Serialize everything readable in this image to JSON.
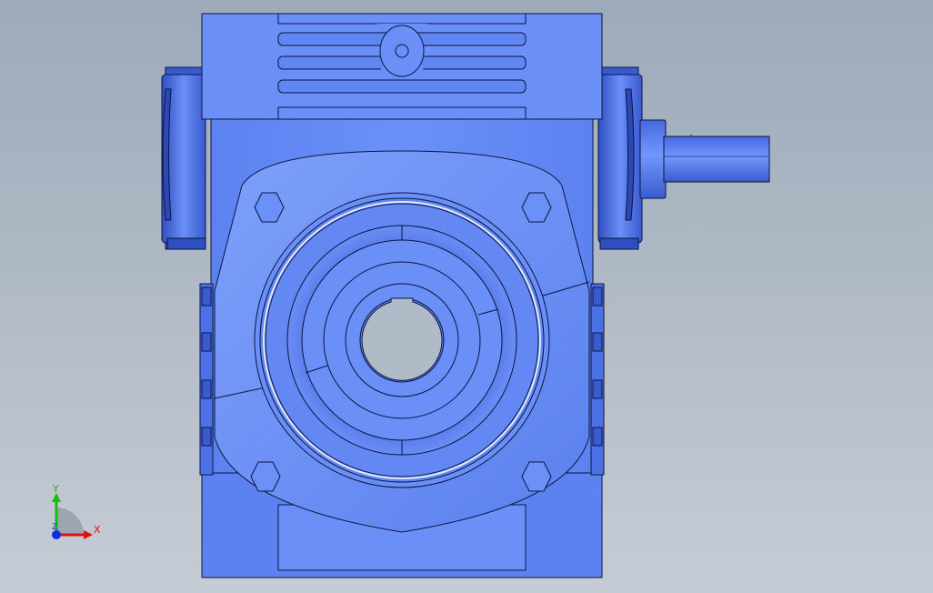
{
  "viewport": {
    "background_top": "#9daab9",
    "background_bottom": "#c6ccd5"
  },
  "model": {
    "body_color": "#5f87f2",
    "body_light": "#7a9dfa",
    "body_dark": "#3a5fd0",
    "edge_color": "#0b1540"
  },
  "triad": {
    "x_label": "X",
    "y_label": "Y",
    "z_label": "Z",
    "x_color": "#e01010",
    "y_color": "#10c010",
    "z_color": "#1030e0"
  }
}
